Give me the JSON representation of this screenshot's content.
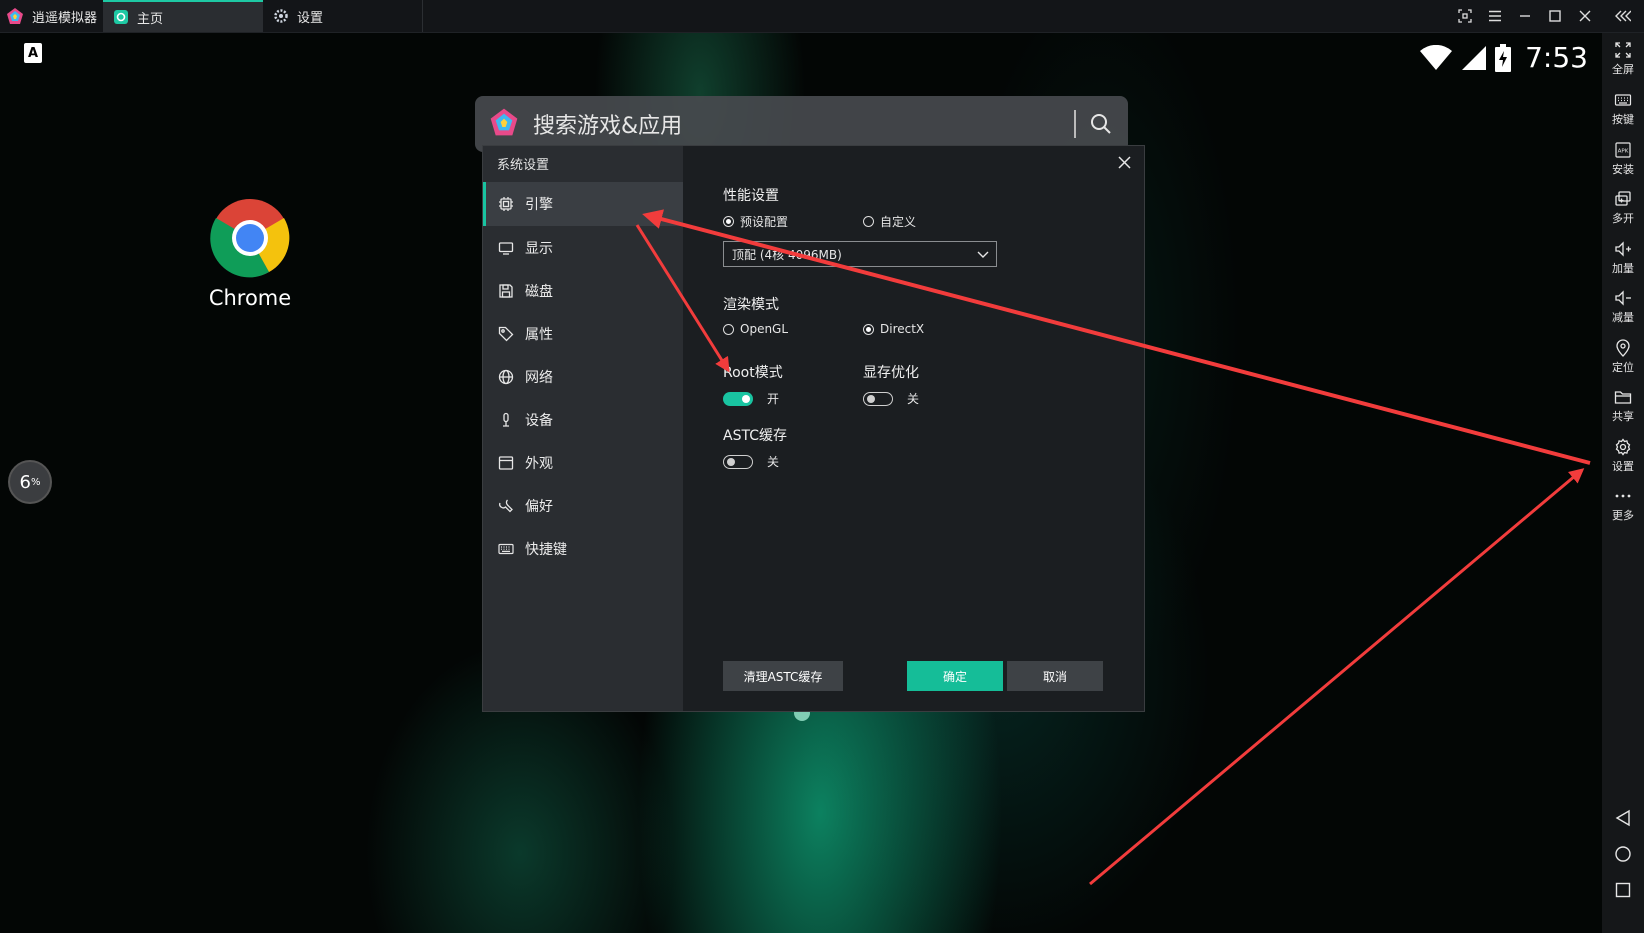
{
  "titlebar": {
    "app_name": "逍遥模拟器",
    "tabs": [
      {
        "label": "主页"
      },
      {
        "label": "设置"
      }
    ]
  },
  "status": {
    "time": "7:53"
  },
  "desktop": {
    "apps": [
      {
        "label": "Chrome"
      }
    ],
    "perf_badge": {
      "value": "6",
      "unit": "%"
    }
  },
  "search": {
    "placeholder": "搜索游戏&应用"
  },
  "dialog": {
    "title": "系统设置",
    "nav": [
      {
        "label": "引擎",
        "icon": "engine-icon",
        "active": true
      },
      {
        "label": "显示",
        "icon": "monitor-icon"
      },
      {
        "label": "磁盘",
        "icon": "disk-icon"
      },
      {
        "label": "属性",
        "icon": "tag-icon"
      },
      {
        "label": "网络",
        "icon": "globe-icon"
      },
      {
        "label": "设备",
        "icon": "microphone-icon"
      },
      {
        "label": "外观",
        "icon": "window-icon"
      },
      {
        "label": "偏好",
        "icon": "wrench-icon"
      },
      {
        "label": "快捷键",
        "icon": "keyboard-icon"
      }
    ],
    "performance": {
      "title": "性能设置",
      "options": [
        {
          "label": "预设配置",
          "selected": true
        },
        {
          "label": "自定义",
          "selected": false
        }
      ],
      "preset_value": "顶配 (4核 4096MB)"
    },
    "render": {
      "title": "渲染模式",
      "options": [
        {
          "label": "OpenGL",
          "selected": false
        },
        {
          "label": "DirectX",
          "selected": true
        }
      ]
    },
    "root": {
      "title": "Root模式",
      "state": "开",
      "on": true
    },
    "vram": {
      "title": "显存优化",
      "state": "关",
      "on": false
    },
    "astc": {
      "title": "ASTC缓存",
      "state": "关",
      "on": false
    },
    "buttons": {
      "clear": "清理ASTC缓存",
      "ok": "确定",
      "cancel": "取消"
    }
  },
  "toolbar": {
    "items": [
      {
        "label": "全屏",
        "icon": "fullscreen-icon"
      },
      {
        "label": "按键",
        "icon": "keyboard-icon"
      },
      {
        "label": "安装",
        "icon": "apk-icon"
      },
      {
        "label": "多开",
        "icon": "multi-instance-icon"
      },
      {
        "label": "加量",
        "icon": "volume-up-icon"
      },
      {
        "label": "减量",
        "icon": "volume-down-icon"
      },
      {
        "label": "定位",
        "icon": "location-icon"
      },
      {
        "label": "共享",
        "icon": "folder-icon"
      },
      {
        "label": "设置",
        "icon": "gear-icon"
      },
      {
        "label": "更多",
        "icon": "more-icon"
      }
    ]
  },
  "colors": {
    "accent": "#19c4a1",
    "annotation": "#f23c3c"
  }
}
